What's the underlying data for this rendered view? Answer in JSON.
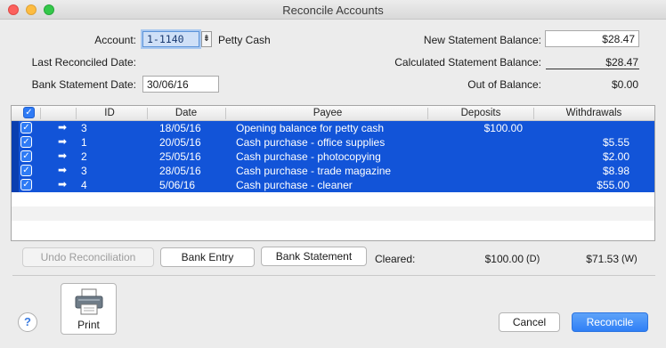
{
  "window": {
    "title": "Reconcile Accounts"
  },
  "form": {
    "account_label": "Account:",
    "account_value": "1-1140",
    "account_name": "Petty Cash",
    "last_reconciled_label": "Last Reconciled Date:",
    "last_reconciled_value": "",
    "bank_statement_date_label": "Bank Statement Date:",
    "bank_statement_date_value": "30/06/16",
    "new_statement_balance_label": "New Statement Balance:",
    "new_statement_balance_value": "$28.47",
    "calculated_balance_label": "Calculated Statement Balance:",
    "calculated_balance_value": "$28.47",
    "out_of_balance_label": "Out of Balance:",
    "out_of_balance_value": "$0.00"
  },
  "table": {
    "columns": [
      "ID",
      "Date",
      "Payee",
      "Deposits",
      "Withdrawals"
    ],
    "rows": [
      {
        "checked": true,
        "arrow": "➡",
        "id": "3",
        "date": "18/05/16",
        "payee": "Opening balance for petty cash",
        "deposit": "$100.00",
        "withdrawal": ""
      },
      {
        "checked": true,
        "arrow": "➡",
        "id": "1",
        "date": "20/05/16",
        "payee": "Cash purchase - office supplies",
        "deposit": "",
        "withdrawal": "$5.55"
      },
      {
        "checked": true,
        "arrow": "➡",
        "id": "2",
        "date": "25/05/16",
        "payee": "Cash purchase - photocopying",
        "deposit": "",
        "withdrawal": "$2.00"
      },
      {
        "checked": true,
        "arrow": "➡",
        "id": "3",
        "date": "28/05/16",
        "payee": "Cash purchase - trade magazine",
        "deposit": "",
        "withdrawal": "$8.98"
      },
      {
        "checked": true,
        "arrow": "➡",
        "id": "4",
        "date": "5/06/16",
        "payee": "Cash purchase - cleaner",
        "deposit": "",
        "withdrawal": "$55.00"
      }
    ]
  },
  "actions": {
    "undo_label": "Undo Reconciliation",
    "bank_entry_label": "Bank Entry",
    "bank_statement_label": "Bank Statement",
    "cleared_label": "Cleared:",
    "cleared_deposits": "$100.00",
    "cleared_deposits_suffix": "(D)",
    "cleared_withdrawals": "$71.53",
    "cleared_withdrawals_suffix": "(W)"
  },
  "footer": {
    "help_label": "?",
    "print_label": "Print",
    "cancel_label": "Cancel",
    "reconcile_label": "Reconcile"
  },
  "colors": {
    "selection": "#1254d8",
    "accent": "#2f7ff6"
  }
}
